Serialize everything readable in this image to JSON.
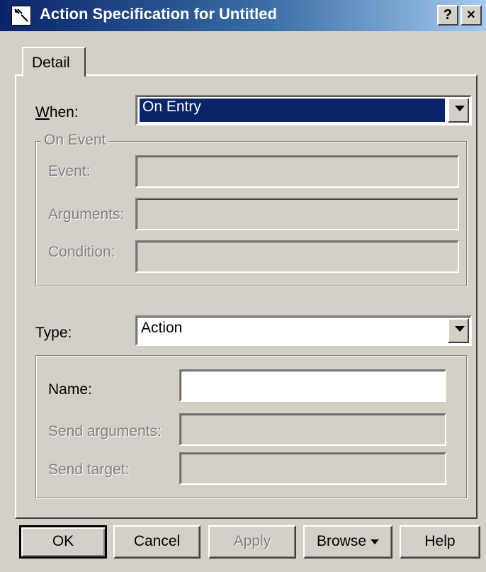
{
  "window": {
    "title": "Action Specification for Untitled",
    "help_caption": "?",
    "close_caption": "×"
  },
  "tabs": [
    {
      "label": "Detail",
      "selected": true
    }
  ],
  "when": {
    "label": "When:",
    "value": "On Entry"
  },
  "on_event": {
    "legend": "On Event",
    "event_label": "Event:",
    "event_value": "",
    "arguments_label": "Arguments:",
    "arguments_value": "",
    "condition_label": "Condition:",
    "condition_value": ""
  },
  "type": {
    "label": "Type:",
    "value": "Action"
  },
  "action": {
    "name_label": "Name:",
    "name_value": "",
    "send_arguments_label": "Send arguments:",
    "send_arguments_value": "",
    "send_target_label": "Send target:",
    "send_target_value": ""
  },
  "buttons": {
    "ok": "OK",
    "cancel": "Cancel",
    "apply": "Apply",
    "browse": "Browse",
    "help": "Help"
  },
  "icons": {
    "app": "action-spec-icon",
    "dropdown": "chevron-down-icon"
  }
}
